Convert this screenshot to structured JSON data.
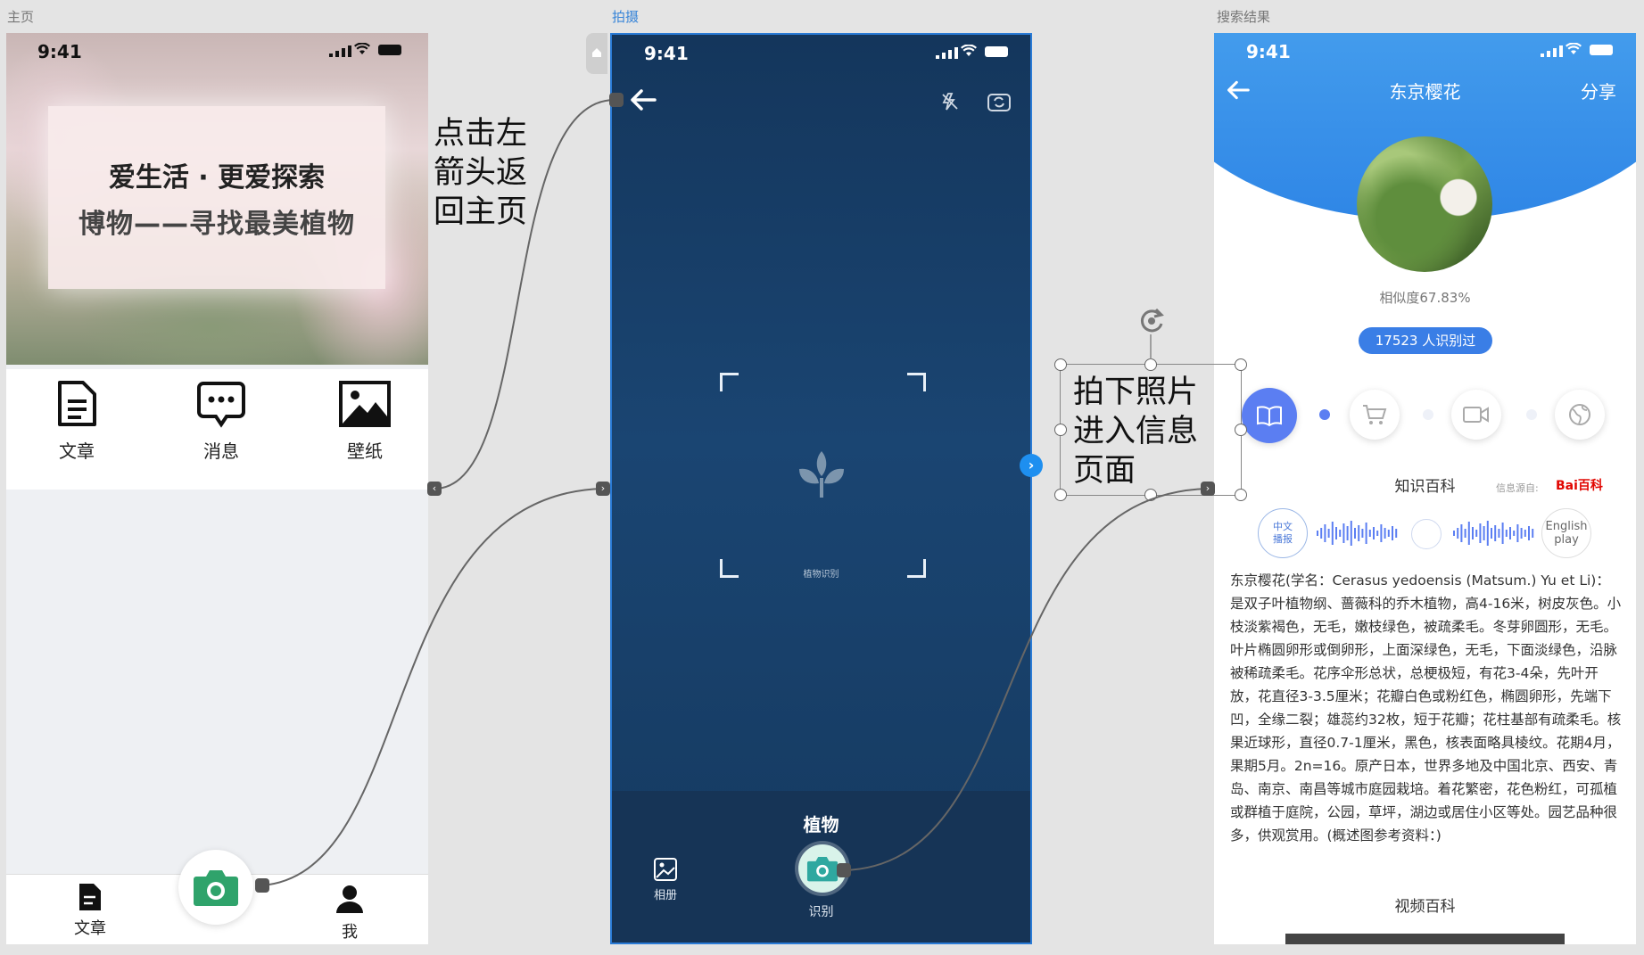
{
  "artboards": {
    "home": "主页",
    "camera": "拍摄",
    "result": "搜索结果"
  },
  "status_time": "9:41",
  "home": {
    "hero_line1": "爱生活 · 更爱探索",
    "hero_line2": "博物——寻找最美植物",
    "quick_items": [
      {
        "label": "文章",
        "icon": "document-icon"
      },
      {
        "label": "消息",
        "icon": "chat-bubble-icon"
      },
      {
        "label": "壁纸",
        "icon": "image-icon"
      }
    ],
    "tabs": [
      {
        "label": "文章",
        "icon": "document-filled-icon"
      },
      {
        "label": "我",
        "icon": "person-icon"
      }
    ],
    "fab_icon": "camera-icon"
  },
  "camera": {
    "scan_label": "植物识别",
    "mode": "植物",
    "album_label": "相册",
    "recognize_label": "识别"
  },
  "result": {
    "title": "东京樱花",
    "share": "分享",
    "similarity": "相似度67.83%",
    "count_badge": "17523 人识别过",
    "knowledge_title": "知识百科",
    "source_label": "信息源自:",
    "source_brand": "Bai百科",
    "audio_cn": "中文播报",
    "audio_en": "English play",
    "body": "东京樱花(学名：Cerasus yedoensis (Matsum.) Yu et Li)：是双子叶植物纲、蔷薇科的乔木植物，高4-16米，树皮灰色。小枝淡紫褐色，无毛，嫩枝绿色，被疏柔毛。冬芽卵圆形，无毛。叶片椭圆卵形或倒卵形，上面深绿色，无毛，下面淡绿色，沿脉被稀疏柔毛。花序伞形总状，总梗极短，有花3-4朵，先叶开放，花直径3-3.5厘米；花瓣白色或粉红色，椭圆卵形，先端下凹，全缘二裂；雄蕊约32枚，短于花瓣；花柱基部有疏柔毛。核果近球形，直径0.7-1厘米，黑色，核表面略具棱纹。花期4月，果期5月。2n=16。原产日本，世界多地及中国北京、西安、青岛、南京、南昌等城市庭园栽培。着花繁密，花色粉红，可孤植或群植于庭院，公园，草坪，湖边或居住小区等处。园艺品种很多，供观赏用。(概述图参考资料：)",
    "video_title": "视频百科"
  },
  "annotations": {
    "back_note": "点击左箭头返回主页",
    "capture_note": "拍下照片进入信息页面"
  },
  "colors": {
    "camera_bg": "#1a4572",
    "result_accent": "#3a7ee6",
    "green_fab": "#2fa36b"
  }
}
